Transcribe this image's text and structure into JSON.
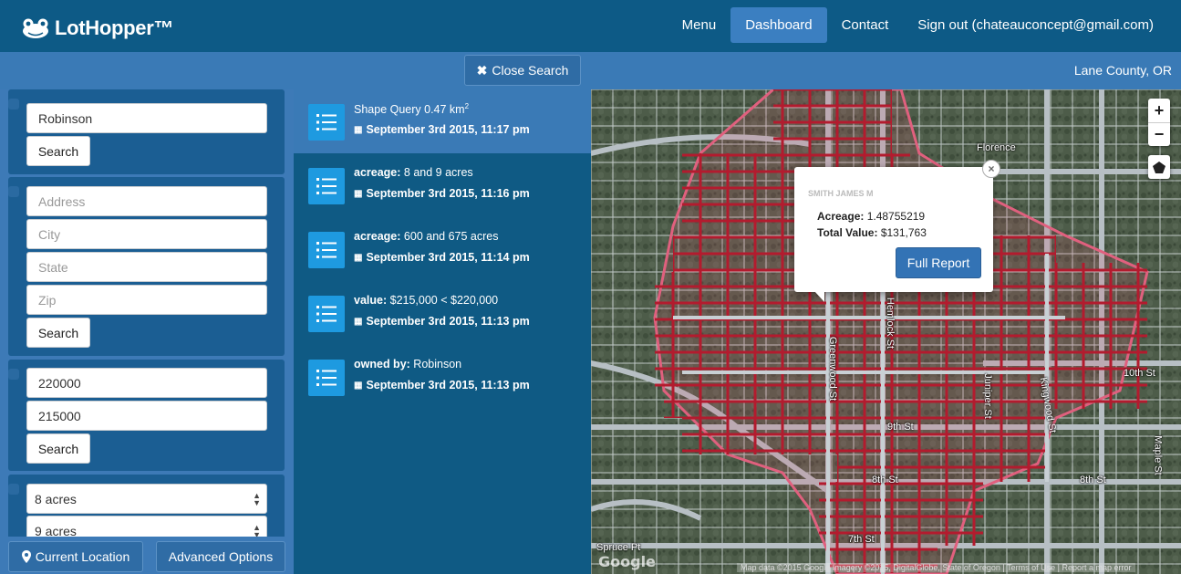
{
  "app": {
    "brand": "LotHopper™"
  },
  "nav": {
    "items": [
      {
        "label": "Menu",
        "active": false
      },
      {
        "label": "Dashboard",
        "active": true
      },
      {
        "label": "Contact",
        "active": false
      },
      {
        "label": "Sign out (chateauconcept@gmail.com)",
        "active": false
      }
    ]
  },
  "subbar": {
    "close_search": "Close Search",
    "county": "Lane County, OR"
  },
  "owner_search": {
    "value": "Robinson",
    "button": "Search"
  },
  "address_search": {
    "address_placeholder": "Address",
    "city_placeholder": "City",
    "state_placeholder": "State",
    "zip_placeholder": "Zip",
    "button": "Search"
  },
  "value_search": {
    "max": "220000",
    "min": "215000",
    "button": "Search"
  },
  "acreage_search": {
    "from": "8 acres",
    "to": "9 acres"
  },
  "footer": {
    "current_location": "Current Location",
    "advanced_options": "Advanced Options"
  },
  "history": [
    {
      "label": "",
      "text": "Shape Query 0.47 km",
      "sup": "2",
      "date": "September 3rd 2015, 11:17 pm",
      "active": true
    },
    {
      "label": "acreage:",
      "text": " 8 and 9 acres",
      "date": "September 3rd 2015, 11:16 pm",
      "active": false
    },
    {
      "label": "acreage:",
      "text": " 600 and 675 acres",
      "date": "September 3rd 2015, 11:14 pm",
      "active": false
    },
    {
      "label": "value:",
      "text": " $215,000 < $220,000",
      "date": "September 3rd 2015, 11:13 pm",
      "active": false
    },
    {
      "label": "owned by:",
      "text": " Robinson",
      "date": "September 3rd 2015, 11:13 pm",
      "active": false
    }
  ],
  "map": {
    "zoom_in": "+",
    "zoom_out": "−",
    "popup": {
      "owner": "SMITH JAMES M",
      "acreage_label": "Acreage:",
      "acreage_value": "1.48755219",
      "value_label": "Total Value:",
      "value_value": "$131,763",
      "button": "Full Report",
      "close": "×"
    },
    "labels": [
      "Florence",
      "Hemlock St",
      "Greenwood St",
      "Juniper St",
      "9th St",
      "8th St",
      "7th St",
      "10th St",
      "8th St",
      "Maple St",
      "Spruce Pt",
      "Kingwood St"
    ],
    "attribution": "Map data ©2015 Google Imagery ©2015, DigitalGlobe, State of Oregon  |  Terms of Use  |  Report a map error",
    "google": "Google",
    "colors": {
      "parcel": "#b31b2e",
      "selection": "#e0607e"
    }
  }
}
